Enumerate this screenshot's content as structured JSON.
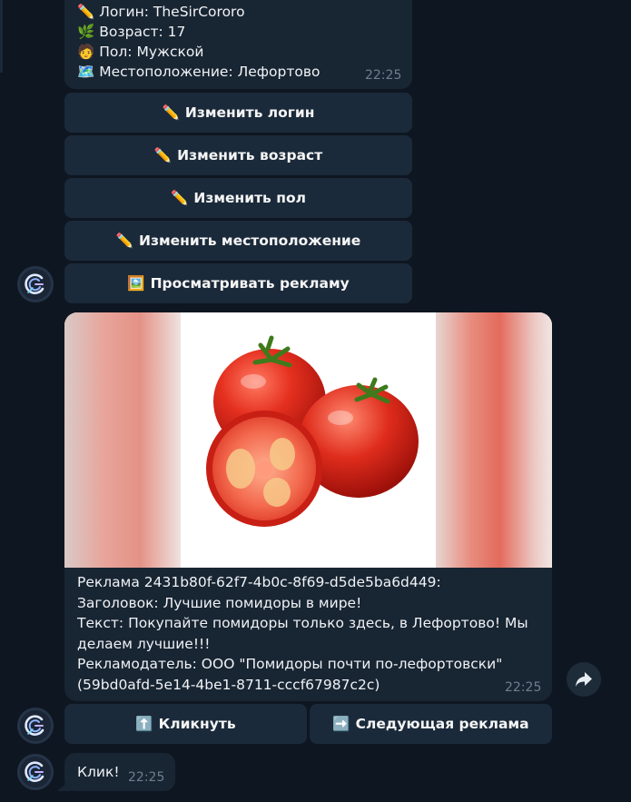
{
  "profile": {
    "lines": [
      {
        "emoji": "✏️",
        "text": "Логин: TheSirCororo"
      },
      {
        "emoji": "🌿",
        "text": "Возраст: 17"
      },
      {
        "emoji": "🧑",
        "text": "Пол: Мужской"
      },
      {
        "emoji": "🗺️",
        "text": "Местоположение: Лефортово"
      }
    ],
    "time": "22:25"
  },
  "keyboard_profile": [
    {
      "emoji": "✏️",
      "label": "Изменить логин"
    },
    {
      "emoji": "✏️",
      "label": "Изменить возраст"
    },
    {
      "emoji": "✏️",
      "label": "Изменить пол"
    },
    {
      "emoji": "✏️",
      "label": "Изменить местоположение"
    },
    {
      "emoji": "🖼️",
      "label": "Просматривать рекламу"
    }
  ],
  "ad": {
    "lines": [
      "Реклама 2431b80f-62f7-4b0c-8f69-d5de5ba6d449:",
      "Заголовок: Лучшие помидоры в мире!",
      "Текст: Покупайте помидоры только здесь, в Лефортово! Мы",
      "делаем лучшие!!!",
      "Рекламодатель: ООО \"Помидоры почти по-лефортовски\"",
      "(59bd0afd-5e14-4be1-8711-cccf67987c2c)"
    ],
    "time": "22:25",
    "image": "tomatoes-photo"
  },
  "keyboard_ad": [
    {
      "emoji": "⬆️",
      "label": "Кликнуть"
    },
    {
      "emoji": "➡️",
      "label": "Следующая реклама"
    }
  ],
  "reply": {
    "text": "Клик!",
    "time": "22:25"
  },
  "icons": {
    "avatar": "bot-avatar-icon",
    "share": "share-arrow-icon"
  },
  "colors": {
    "background": "#0e1621",
    "bubble": "#182533",
    "button": "#1b2a3a",
    "time": "#6d7f8f"
  }
}
